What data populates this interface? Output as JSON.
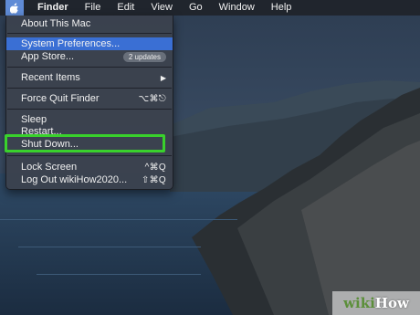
{
  "menubar": {
    "apple_icon": "apple-logo-icon",
    "items": [
      "Finder",
      "File",
      "Edit",
      "View",
      "Go",
      "Window",
      "Help"
    ]
  },
  "apple_menu": {
    "about": "About This Mac",
    "system_preferences": "System Preferences...",
    "app_store": "App Store...",
    "app_store_badge": "2 updates",
    "recent_items": "Recent Items",
    "force_quit": "Force Quit Finder",
    "force_quit_shortcut": "⌥⌘⎋",
    "sleep": "Sleep",
    "restart": "Restart...",
    "shut_down": "Shut Down...",
    "lock_screen": "Lock Screen",
    "lock_screen_shortcut": "^⌘Q",
    "log_out": "Log Out wikiHow2020...",
    "log_out_shortcut": "⇧⌘Q"
  },
  "watermark": {
    "part1": "wiki",
    "part2": "How"
  },
  "colors": {
    "selection": "#3a6fd4",
    "highlight_box": "#39d12c",
    "menubar_bg": "#20242c"
  }
}
